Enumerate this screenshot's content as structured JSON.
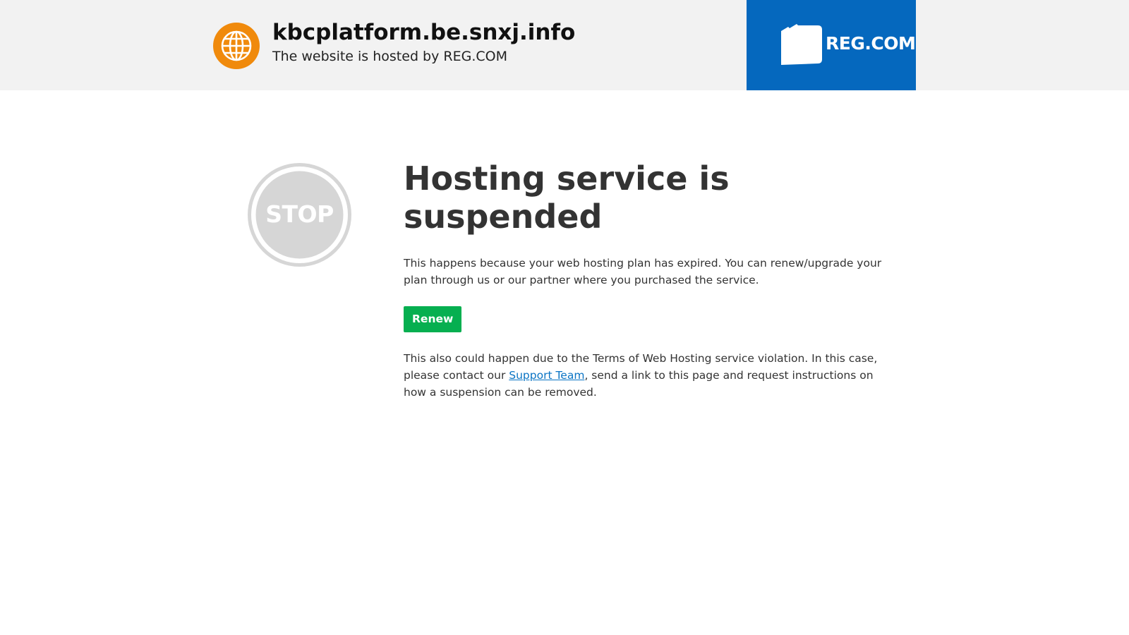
{
  "header": {
    "site_name": "kbcplatform.be.snxj.info",
    "hosted_by": "The website is hosted by REG.COM",
    "logo_text": "REG.COM",
    "logo_bg": "#0568be",
    "globe_color": "#f08a0c"
  },
  "main": {
    "stop_label": "STOP",
    "title": "Hosting service is suspended",
    "paragraph1": "This happens because your web hosting plan has expired. You can renew/upgrade your plan through us or our partner where you purchased the service.",
    "renew_label": "Renew",
    "renew_color": "#06af50",
    "paragraph2_before": "This also could happen due to the Terms of Web Hosting service violation. In this case, please contact our ",
    "support_link": "Support Team",
    "paragraph2_after": ", send a link to this page and request instructions on how a suspension can be removed.",
    "link_color": "#0a74c4"
  }
}
